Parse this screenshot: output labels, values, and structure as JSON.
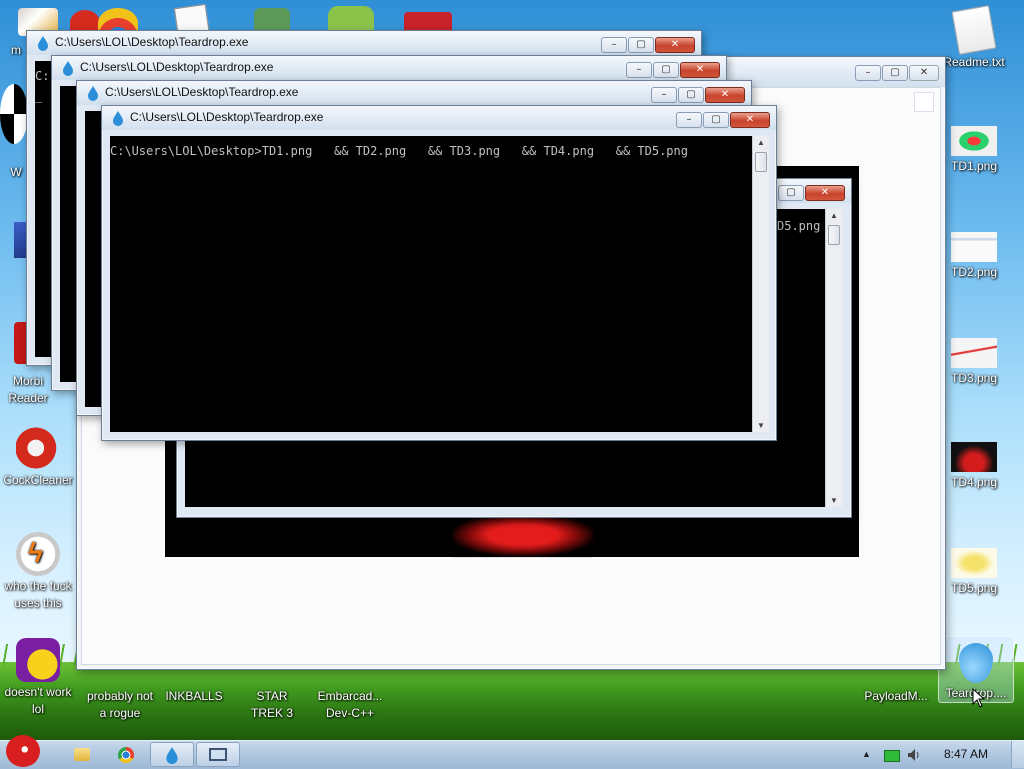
{
  "desktop_icons_left": [
    {
      "label": "m"
    },
    {
      "label": "W"
    },
    {
      "label": "Morbi Reader"
    },
    {
      "label": "CockCleaner"
    },
    {
      "label": "who the fuck uses this"
    },
    {
      "label": "doesn't work lol"
    }
  ],
  "desktop_icons_bottom": [
    {
      "label": "probably not a rogue"
    },
    {
      "label": "INKBALLS"
    },
    {
      "label": "STAR TREK 3"
    },
    {
      "label": "Embarcad... Dev-C++"
    },
    {
      "label": "PayloadM..."
    }
  ],
  "desktop_icons_right": [
    {
      "label": "Readme.txt"
    },
    {
      "label": "TD1.png"
    },
    {
      "label": "TD2.png"
    },
    {
      "label": "TD3.png"
    },
    {
      "label": "TD4.png"
    },
    {
      "label": "TD5.png"
    },
    {
      "label": "Teardrop...."
    }
  ],
  "windows": {
    "title": "C:\\Users\\LOL\\Desktop\\Teardrop.exe",
    "console_command": "C:\\Users\\LOL\\Desktop>TD1.png   && TD2.png   && TD3.png   && TD4.png   && TD5.png",
    "partial_text_back": "D5.png",
    "left_stub_prompt": "C:",
    "cursor": "_"
  },
  "window_buttons": {
    "minimize": "–",
    "maximize": "▢",
    "close": "✕"
  },
  "taskbar": {
    "clock": "8:47 AM",
    "tray_arrow": "▲"
  },
  "colors": {
    "console_bg": "#000000",
    "console_text": "#c0c0c0",
    "close_red": "#c8442c",
    "taskbar": "#b1c8e1"
  },
  "icons": [
    "angry-bird-start-icon",
    "folder-icon",
    "chrome-icon",
    "teardrop-icon",
    "window-switch-icon",
    "battery-icon",
    "volume-icon"
  ]
}
